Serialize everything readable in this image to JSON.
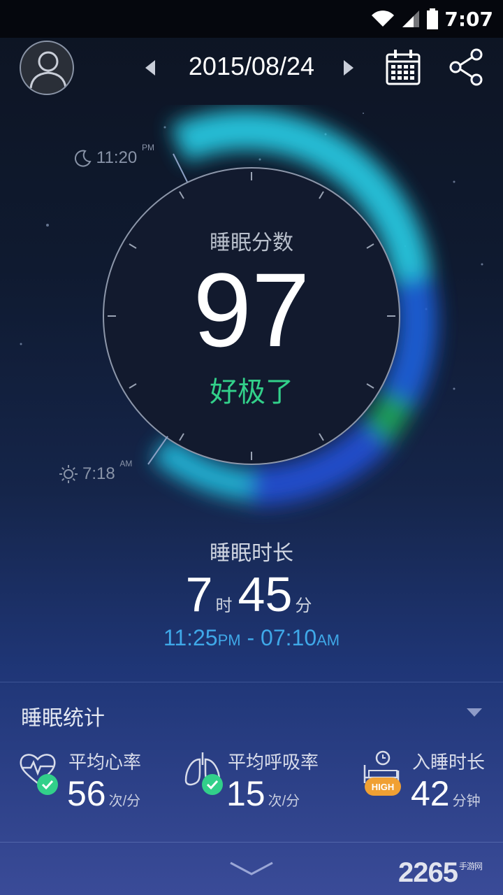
{
  "status_bar": {
    "time": "7:07"
  },
  "header": {
    "date": "2015/08/24"
  },
  "dial": {
    "bedtime": "11:20",
    "bedtime_ampm": "PM",
    "waketime": "7:18",
    "waketime_ampm": "AM"
  },
  "score": {
    "label": "睡眠分数",
    "value": "97",
    "rating": "好极了"
  },
  "duration": {
    "label": "睡眠时长",
    "hours": "7",
    "hours_unit": "时",
    "minutes": "45",
    "minutes_unit": "分",
    "start": "11:25",
    "start_ampm": "PM",
    "separator": " - ",
    "end": "07:10",
    "end_ampm": "AM"
  },
  "stats": {
    "title": "睡眠统计",
    "items": [
      {
        "name": "平均心率",
        "value": "56",
        "unit": "次/分"
      },
      {
        "name": "平均呼吸率",
        "value": "15",
        "unit": "次/分"
      },
      {
        "name": "入睡时长",
        "value": "42",
        "unit": "分钟",
        "badge": "HIGH"
      }
    ]
  },
  "watermark": {
    "text": "2265",
    "sub": "手游网"
  },
  "colors": {
    "accent_green": "#32d08a",
    "accent_blue": "#3fa8e8",
    "badge_orange": "#f0a033"
  }
}
